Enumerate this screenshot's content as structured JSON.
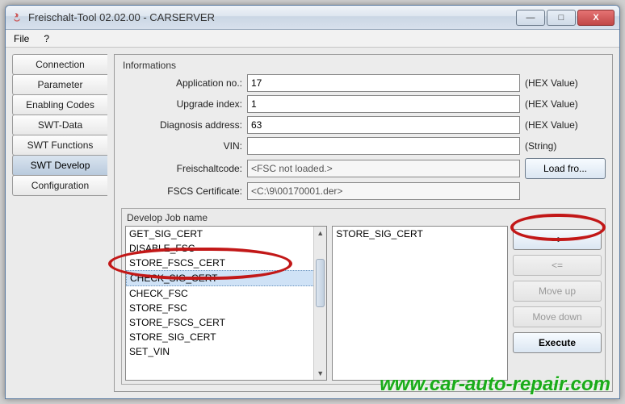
{
  "window": {
    "title": "Freischalt-Tool 02.02.00 - CARSERVER",
    "buttons": {
      "min": "—",
      "max": "□",
      "close": "X"
    }
  },
  "menu": {
    "file": "File",
    "help": "?"
  },
  "tabs": [
    {
      "label": "Connection"
    },
    {
      "label": "Parameter"
    },
    {
      "label": "Enabling Codes"
    },
    {
      "label": "SWT-Data"
    },
    {
      "label": "SWT Functions"
    },
    {
      "label": "SWT Develop",
      "active": true
    },
    {
      "label": "Configuration"
    }
  ],
  "info": {
    "heading": "Informations",
    "app_no_label": "Application no.:",
    "app_no_value": "17",
    "app_no_suffix": "(HEX Value)",
    "upgrade_label": "Upgrade index:",
    "upgrade_value": "1",
    "upgrade_suffix": "(HEX Value)",
    "diag_label": "Diagnosis address:",
    "diag_value": "63",
    "diag_suffix": "(HEX Value)",
    "vin_label": "VIN:",
    "vin_value": "",
    "vin_suffix": "(String)",
    "fsc_label": "Freischaltcode:",
    "fsc_value": "<FSC not loaded.>",
    "load_button": "Load fro...",
    "cert_label": "FSCS Certificate:",
    "cert_value": "<C:\\9\\00170001.der>"
  },
  "develop": {
    "heading": "Develop Job name",
    "left_list": [
      "GET_SIG_CERT",
      "DISABLE_FSC",
      "STORE_FSCS_CERT",
      "CHECK_SIG_CERT",
      "CHECK_FSC",
      "STORE_FSC",
      "STORE_FSCS_CERT",
      "STORE_SIG_CERT",
      "SET_VIN"
    ],
    "left_selected_index": 3,
    "right_list": [
      "STORE_SIG_CERT"
    ],
    "buttons": {
      "add": "=>",
      "remove": "<=",
      "moveup": "Move up",
      "movedown": "Move down",
      "execute": "Execute"
    }
  },
  "watermark": "www.car-auto-repair.com"
}
